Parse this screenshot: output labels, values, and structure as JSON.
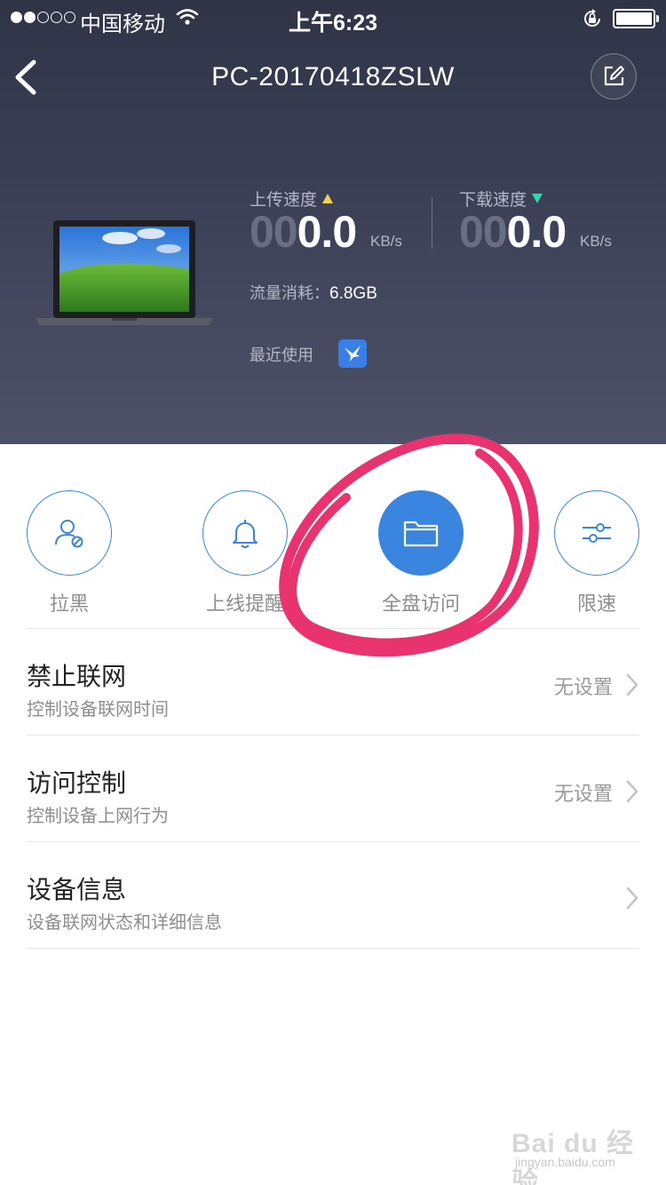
{
  "status_bar": {
    "carrier": "中国移动",
    "time": "上午6:23"
  },
  "nav": {
    "title": "PC-20170418ZSLW"
  },
  "device": {
    "upload": {
      "label": "上传速度",
      "leading_zeros": "00",
      "value": "0.0",
      "unit": "KB/s"
    },
    "download": {
      "label": "下载速度",
      "leading_zeros": "00",
      "value": "0.0",
      "unit": "KB/s"
    },
    "usage_label": "流量消耗：",
    "usage_value": "6.8GB",
    "recent_label": "最近使用"
  },
  "actions": [
    {
      "label": "拉黑",
      "icon": "user-block-icon"
    },
    {
      "label": "上线提醒",
      "icon": "bell-icon"
    },
    {
      "label": "全盘访问",
      "icon": "folder-icon",
      "active": true
    },
    {
      "label": "限速",
      "icon": "sliders-icon"
    }
  ],
  "menu": [
    {
      "title": "禁止联网",
      "subtitle": "控制设备联网时间",
      "value": "无设置"
    },
    {
      "title": "访问控制",
      "subtitle": "控制设备上网行为",
      "value": "无设置"
    },
    {
      "title": "设备信息",
      "subtitle": "设备联网状态和详细信息",
      "value": ""
    }
  ],
  "watermark": {
    "main": "Bai du 经验",
    "sub": "jingyan.baidu.com"
  },
  "colors": {
    "accent": "#3a85e0",
    "header_bg": "#3b4057",
    "annotation": "#e8336f"
  }
}
